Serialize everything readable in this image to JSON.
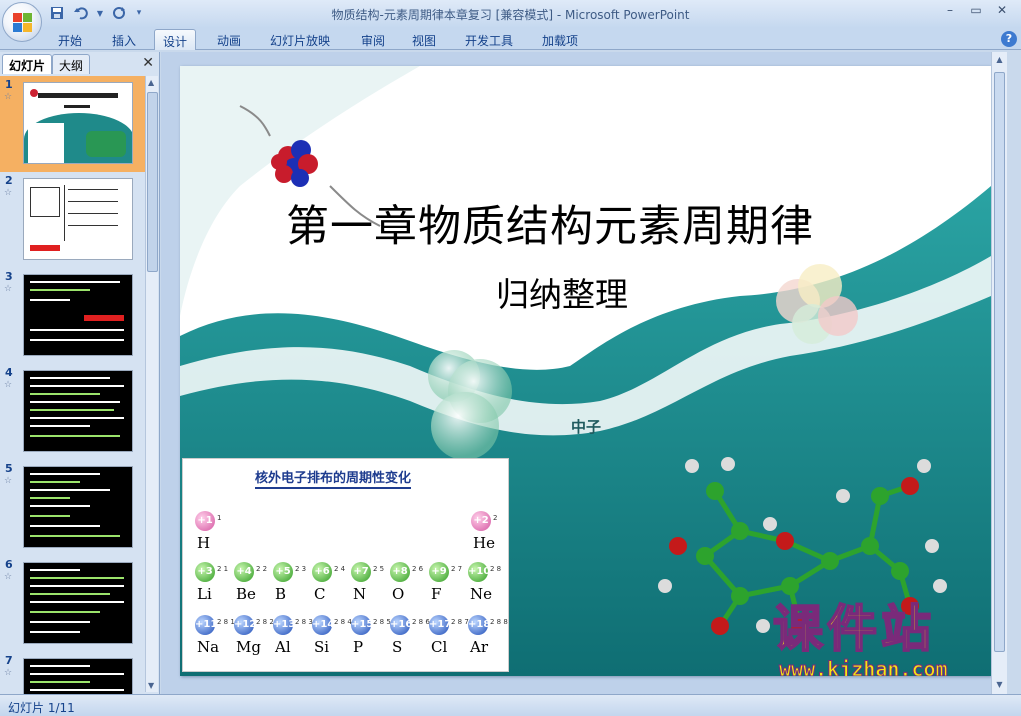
{
  "window": {
    "title": "物质结构-元素周期律本章复习 [兼容模式] - Microsoft PowerPoint",
    "controls": [
      "–",
      "▭",
      "✕"
    ]
  },
  "ribbon": {
    "tabs": [
      "开始",
      "插入",
      "设计",
      "动画",
      "幻灯片放映",
      "审阅",
      "视图",
      "开发工具",
      "加载项"
    ],
    "active_tab": "设计",
    "help": "?"
  },
  "left_panel": {
    "tabs": [
      "幻灯片",
      "大纲"
    ],
    "close": "✕",
    "thumbnails": [
      {
        "num": "1"
      },
      {
        "num": "2"
      },
      {
        "num": "3"
      },
      {
        "num": "4"
      },
      {
        "num": "5"
      },
      {
        "num": "6"
      },
      {
        "num": "7"
      }
    ]
  },
  "slide": {
    "title": "第一章物质结构元素周期律",
    "subtitle": "归纳整理",
    "neutron_label": "中子",
    "table_title": "核外电子排布的周期性变化",
    "elements": [
      {
        "charge": "+1",
        "shell": "1",
        "symbol": "H",
        "color": "pink"
      },
      {
        "charge": "+2",
        "shell": "2",
        "symbol": "He",
        "color": "pink"
      },
      {
        "charge": "+3",
        "shell": "2 1",
        "symbol": "Li",
        "color": "green"
      },
      {
        "charge": "+4",
        "shell": "2 2",
        "symbol": "Be",
        "color": "green"
      },
      {
        "charge": "+5",
        "shell": "2 3",
        "symbol": "B",
        "color": "green"
      },
      {
        "charge": "+6",
        "shell": "2 4",
        "symbol": "C",
        "color": "green"
      },
      {
        "charge": "+7",
        "shell": "2 5",
        "symbol": "N",
        "color": "green"
      },
      {
        "charge": "+8",
        "shell": "2 6",
        "symbol": "O",
        "color": "green"
      },
      {
        "charge": "+9",
        "shell": "2 7",
        "symbol": "F",
        "color": "green"
      },
      {
        "charge": "+10",
        "shell": "2 8",
        "symbol": "Ne",
        "color": "green"
      },
      {
        "charge": "+11",
        "shell": "2 8 1",
        "symbol": "Na",
        "color": "blue"
      },
      {
        "charge": "+12",
        "shell": "2 8 2",
        "symbol": "Mg",
        "color": "blue"
      },
      {
        "charge": "+13",
        "shell": "2 8 3",
        "symbol": "Al",
        "color": "blue"
      },
      {
        "charge": "+14",
        "shell": "2 8 4",
        "symbol": "Si",
        "color": "blue"
      },
      {
        "charge": "+15",
        "shell": "2 8 5",
        "symbol": "P",
        "color": "blue"
      },
      {
        "charge": "+16",
        "shell": "2 8 6",
        "symbol": "S",
        "color": "blue"
      },
      {
        "charge": "+17",
        "shell": "2 8 7",
        "symbol": "Cl",
        "color": "blue"
      },
      {
        "charge": "+18",
        "shell": "2 8 8",
        "symbol": "Ar",
        "color": "blue"
      }
    ],
    "watermark": {
      "big": "课件站",
      "url": "www.kjzhan.com"
    }
  },
  "status": {
    "slide_counter": "幻灯片 1/11"
  },
  "colors": {
    "accent": "#15428b",
    "teal": "#1f8a8a",
    "selection": "#f5b062"
  }
}
